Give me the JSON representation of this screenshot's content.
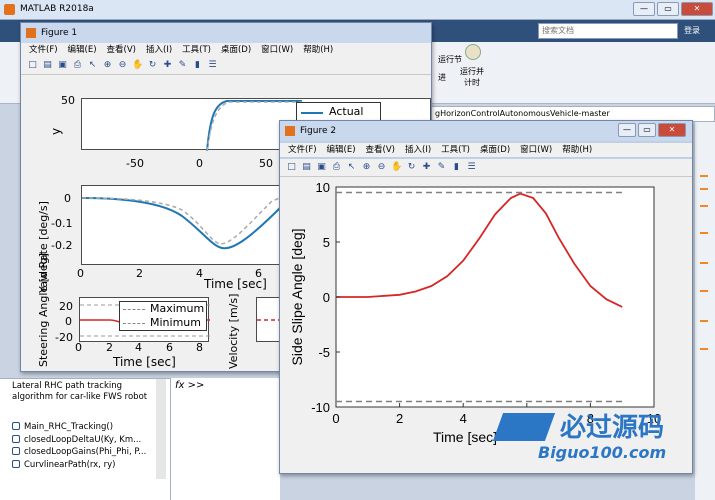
{
  "matlab": {
    "title": "MATLAB R2018a",
    "search_placeholder": "搜索文档",
    "login": "登录",
    "toolstrip_run_section": "运行节",
    "toolstrip_advance": "进",
    "toolstrip_run_time": "运行并\n计时",
    "path": "gHorizonControlAutonomousVehicle-master",
    "file_description": "Lateral RHC path tracking algorithm for car-like FWS robot",
    "files": [
      "Main_RHC_Tracking()",
      "closedLoopDeltaU(Ky, Km...",
      "closedLoopGains(Phi_Phi, P...",
      "CurvlinearPath(rx, ry)"
    ],
    "cmd_prompt": "fx >>"
  },
  "fig1": {
    "title": "Figure 1",
    "menu": [
      "文件(F)",
      "编辑(E)",
      "查看(V)",
      "插入(I)",
      "工具(T)",
      "桌面(D)",
      "窗口(W)",
      "帮助(H)"
    ],
    "top": {
      "ylabel": "y",
      "xticks": [
        "-50",
        "0",
        "50"
      ],
      "ytick": "50",
      "legend": "Actual"
    },
    "mid": {
      "ylabel": "Yaw Rate [deg/s]",
      "xlabel": "Time [sec]",
      "xticks": [
        "0",
        "2",
        "4",
        "6"
      ],
      "yticks": [
        "0",
        "-0.1",
        "-0.2"
      ]
    },
    "steer": {
      "ylabel": "Steering Angle [deg]",
      "xlabel": "Time [sec]",
      "xticks": [
        "0",
        "2",
        "4",
        "6",
        "8"
      ],
      "yticks": [
        "20",
        "0",
        "-20"
      ],
      "legend": [
        "Maximum",
        "Minimum"
      ]
    },
    "vel": {
      "ylabel": "Velocity [m/s]"
    }
  },
  "fig2": {
    "title": "Figure 2",
    "menu": [
      "文件(F)",
      "编辑(E)",
      "查看(V)",
      "插入(I)",
      "工具(T)",
      "桌面(D)",
      "窗口(W)",
      "帮助(H)"
    ]
  },
  "chart_data": {
    "type": "line",
    "xlabel": "Time [sec]",
    "ylabel": "Side Slipe Angle [deg]",
    "xlim": [
      0,
      10
    ],
    "ylim": [
      -10,
      10
    ],
    "xticks": [
      "0",
      "2",
      "4",
      "6",
      "8",
      "10"
    ],
    "yticks": [
      "10",
      "5",
      "0",
      "-5",
      "-10"
    ],
    "grid": false,
    "series": [
      {
        "x": [
          0,
          1,
          2,
          2.5,
          3,
          3.5,
          4,
          4.5,
          5,
          5.5,
          5.8,
          6.2,
          6.6,
          7,
          7.5,
          8,
          8.5,
          9
        ],
        "y": [
          0,
          0,
          0.2,
          0.5,
          1.0,
          1.9,
          3.3,
          5.3,
          7.5,
          9.0,
          9.4,
          9.0,
          7.6,
          5.4,
          3.0,
          1.0,
          -0.2,
          -0.9
        ],
        "color": "#d62728"
      },
      {
        "x": [
          0,
          9
        ],
        "y": [
          9.5,
          9.5
        ],
        "color": "#808080",
        "dashed": true
      },
      {
        "x": [
          0,
          9
        ],
        "y": [
          -9.5,
          -9.5
        ],
        "color": "#808080",
        "dashed": true
      }
    ]
  },
  "watermark": {
    "brand": "必过源码",
    "url": "Biguo100.com"
  }
}
